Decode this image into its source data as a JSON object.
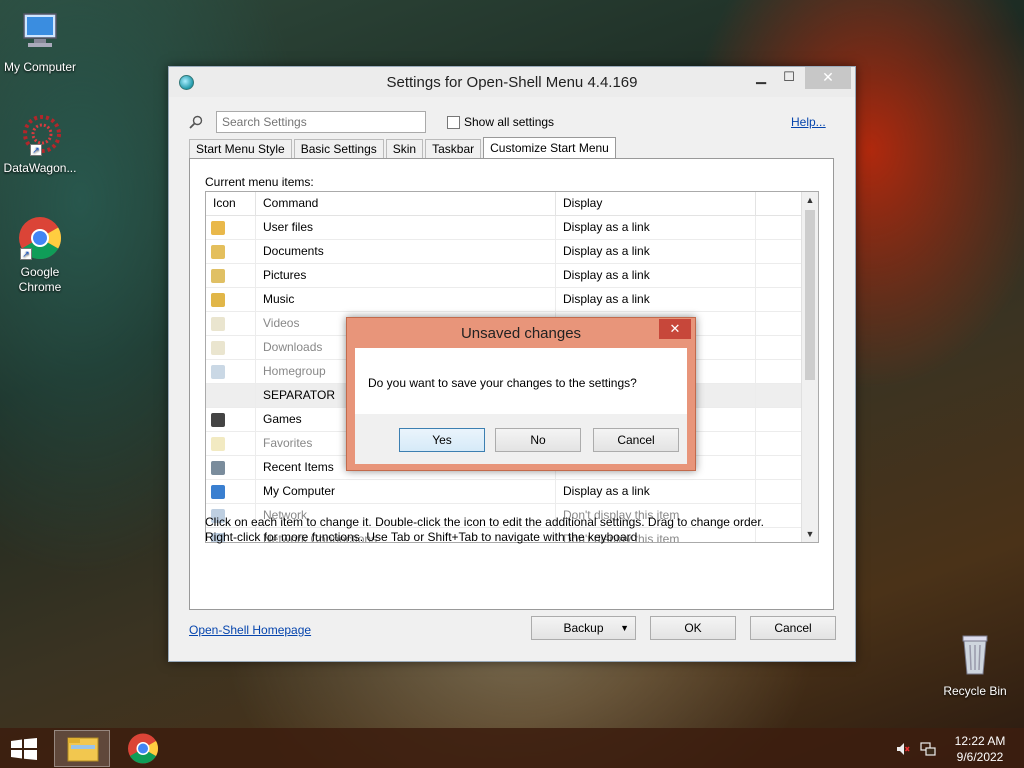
{
  "desktop": {
    "icons": [
      {
        "label": "My Computer"
      },
      {
        "label": "DataWagon..."
      },
      {
        "label": "Google Chrome"
      },
      {
        "label": "Recycle Bin"
      }
    ]
  },
  "window": {
    "title": "Settings for Open-Shell Menu 4.4.169",
    "search_placeholder": "Search Settings",
    "show_all_label": "Show all settings",
    "help_label": "Help...",
    "tabs": [
      {
        "label": "Start Menu Style"
      },
      {
        "label": "Basic Settings"
      },
      {
        "label": "Skin"
      },
      {
        "label": "Taskbar"
      },
      {
        "label": "Customize Start Menu",
        "active": true
      }
    ],
    "panel_label": "Current menu items:",
    "columns": {
      "icon": "Icon",
      "command": "Command",
      "display": "Display"
    },
    "rows": [
      {
        "command": "User files",
        "display": "Display as a link",
        "icon": "user-folder-icon",
        "dim": false
      },
      {
        "command": "Documents",
        "display": "Display as a link",
        "icon": "documents-icon",
        "dim": false
      },
      {
        "command": "Pictures",
        "display": "Display as a link",
        "icon": "pictures-icon",
        "dim": false
      },
      {
        "command": "Music",
        "display": "Display as a link",
        "icon": "music-icon",
        "dim": false
      },
      {
        "command": "Videos",
        "display": "",
        "icon": "videos-icon",
        "dim": true
      },
      {
        "command": "Downloads",
        "display": "",
        "icon": "downloads-icon",
        "dim": true
      },
      {
        "command": "Homegroup",
        "display": "",
        "icon": "homegroup-icon",
        "dim": true
      },
      {
        "command": "SEPARATOR",
        "display": "",
        "icon": "",
        "dim": false,
        "separator": true
      },
      {
        "command": "Games",
        "display": "",
        "icon": "games-icon",
        "dim": false
      },
      {
        "command": "Favorites",
        "display": "",
        "icon": "favorites-icon",
        "dim": true
      },
      {
        "command": "Recent Items",
        "display": "",
        "icon": "recent-items-icon",
        "dim": false
      },
      {
        "command": "My Computer",
        "display": "Display as a link",
        "icon": "computer-icon",
        "dim": false
      },
      {
        "command": "Network",
        "display": "Don't display this item",
        "icon": "network-icon",
        "dim": true
      },
      {
        "command": "Network Connections",
        "display": "Don't display this item",
        "icon": "network-connections-icon",
        "dim": true
      }
    ],
    "hint_line1": "Click on each item to change it. Double-click the icon to edit the additional settings. Drag to change order.",
    "hint_line2": "Right-click for more functions. Use Tab or Shift+Tab to navigate with the keyboard",
    "homepage_label": "Open-Shell Homepage",
    "backup_label": "Backup",
    "ok_label": "OK",
    "cancel_label": "Cancel"
  },
  "dialog": {
    "title": "Unsaved changes",
    "message": "Do you want to save your changes to the settings?",
    "yes_label": "Yes",
    "no_label": "No",
    "cancel_label": "Cancel"
  },
  "taskbar": {
    "time": "12:22 AM",
    "date": "9/6/2022"
  },
  "colors": {
    "dialog_frame": "#e8957a",
    "link": "#0645ad",
    "dialog_close": "#c7473a"
  }
}
